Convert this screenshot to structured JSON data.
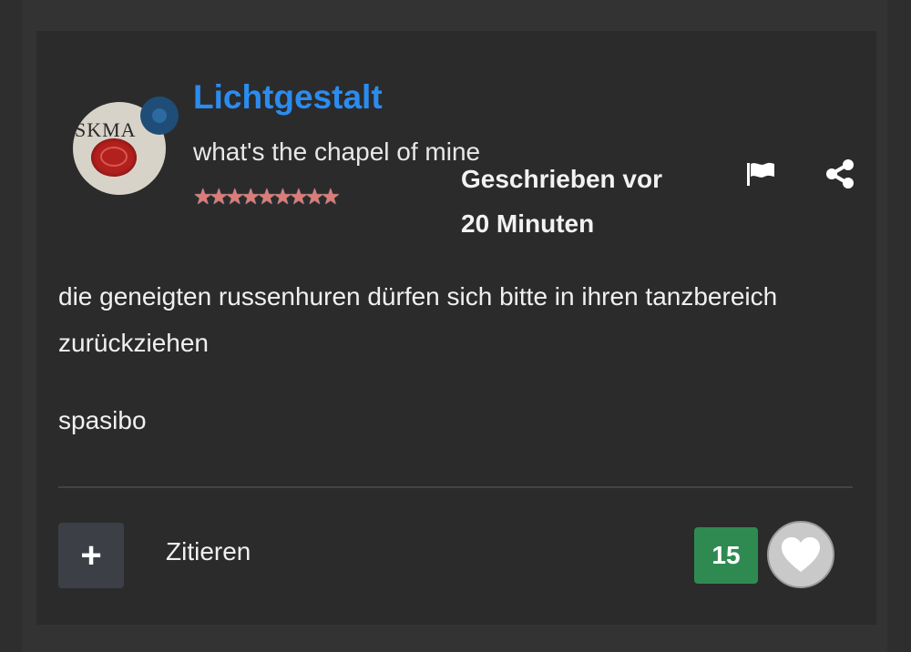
{
  "post": {
    "author": {
      "name": "Lichtgestalt",
      "tagline": "what's the chapel of mine",
      "rank_stars": "★★★★★★★★★",
      "avatar_text": "SKMA"
    },
    "meta": {
      "posted_label": "Geschrieben vor",
      "posted_time": "20 Minuten"
    },
    "body": {
      "paragraphs": [
        "die geneigten russenhuren dürfen sich bitte in ihren tanzbereich zurückziehen",
        "spasibo"
      ]
    },
    "footer": {
      "plus_label": "+",
      "quote_label": "Zitieren",
      "like_count": "15"
    }
  },
  "colors": {
    "username": "#2b8cf0",
    "like_count_bg": "#2f8a52",
    "card_bg": "#2b2b2b"
  },
  "icons": [
    "flag-icon",
    "share-icon",
    "heart-icon",
    "plus-icon"
  ]
}
